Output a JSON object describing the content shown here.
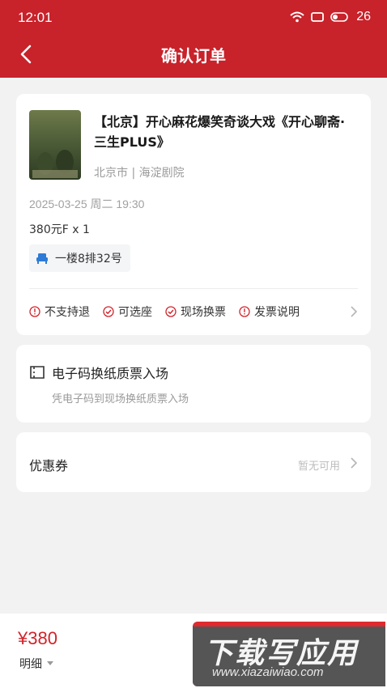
{
  "status_bar": {
    "time": "12:01",
    "battery": "26"
  },
  "header": {
    "title": "确认订单"
  },
  "show": {
    "title": "【北京】开心麻花爆笑奇谈大戏《开心聊斋·三生PLUS》",
    "venue": "北京市 | 海淀剧院",
    "datetime": "2025-03-25 周二 19:30",
    "price_qty": "380元F x 1",
    "seat": "一楼8排32号",
    "poster_text": "开心聊斋 三生"
  },
  "policies": [
    {
      "label": "不支持退",
      "icon": "alert-circle-icon"
    },
    {
      "label": "可选座",
      "icon": "check-circle-icon"
    },
    {
      "label": "现场换票",
      "icon": "check-circle-icon"
    },
    {
      "label": "发票说明",
      "icon": "alert-circle-icon"
    }
  ],
  "ticket": {
    "type": "电子码换纸质票入场",
    "desc": "凭电子码到现场换纸质票入场"
  },
  "coupon": {
    "label": "优惠券",
    "value": "暂无可用"
  },
  "bottom": {
    "total": "¥380",
    "detail": "明细",
    "watermark_main": "下载写应用",
    "watermark_url": "www.xiazaiwiao.com"
  },
  "colors": {
    "brand": "#c8222a",
    "price": "#d1232a"
  }
}
